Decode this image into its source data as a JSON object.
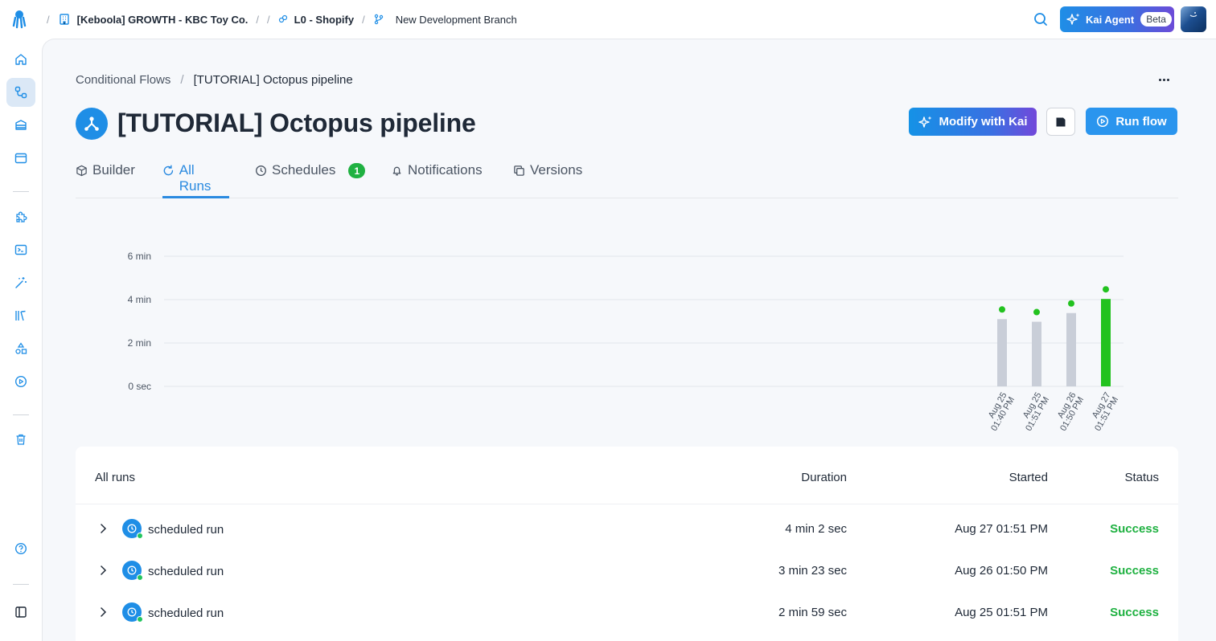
{
  "topbar": {
    "project": "[Keboola] GROWTH - KBC Toy Co.",
    "flow_crumb": "L0 - Shopify",
    "branch": "New Development Branch",
    "kai_label": "Kai Agent",
    "kai_badge": "Beta"
  },
  "breadcrumb": {
    "parent": "Conditional Flows",
    "current": "[TUTORIAL] Octopus pipeline"
  },
  "page": {
    "title": "[TUTORIAL] Octopus pipeline",
    "modify_label": "Modify with Kai",
    "run_label": "Run flow"
  },
  "tabs": [
    {
      "label": "Builder"
    },
    {
      "label": "All Runs"
    },
    {
      "label": "Schedules",
      "badge": "1"
    },
    {
      "label": "Notifications"
    },
    {
      "label": "Versions"
    }
  ],
  "colors": {
    "accent": "#2a95ee",
    "success": "#1fb141",
    "bar_default": "#c9ced8",
    "bar_latest": "#22c21f"
  },
  "chart_data": {
    "type": "bar",
    "y_ticks": [
      "6 min",
      "4 min",
      "2 min",
      "0 sec"
    ],
    "ylim": [
      0,
      6
    ],
    "y_unit": "min",
    "x_tick_lines": [
      [
        "Aug 25",
        "01:40 PM"
      ],
      [
        "Aug 25",
        "01:51 PM"
      ],
      [
        "Aug 26",
        "01:50 PM"
      ],
      [
        "Aug 27",
        "01:51 PM"
      ]
    ],
    "values": [
      3.1,
      2.98,
      3.38,
      4.03
    ],
    "status": [
      "success",
      "success",
      "success",
      "success"
    ],
    "grid": true
  },
  "table": {
    "headers": {
      "name": "All runs",
      "duration": "Duration",
      "started": "Started",
      "status": "Status"
    },
    "rows": [
      {
        "name": "scheduled run",
        "duration": "4 min 2 sec",
        "started": "Aug 27 01:51 PM",
        "status": "Success"
      },
      {
        "name": "scheduled run",
        "duration": "3 min 23 sec",
        "started": "Aug 26 01:50 PM",
        "status": "Success"
      },
      {
        "name": "scheduled run",
        "duration": "2 min 59 sec",
        "started": "Aug 25 01:51 PM",
        "status": "Success"
      }
    ]
  }
}
